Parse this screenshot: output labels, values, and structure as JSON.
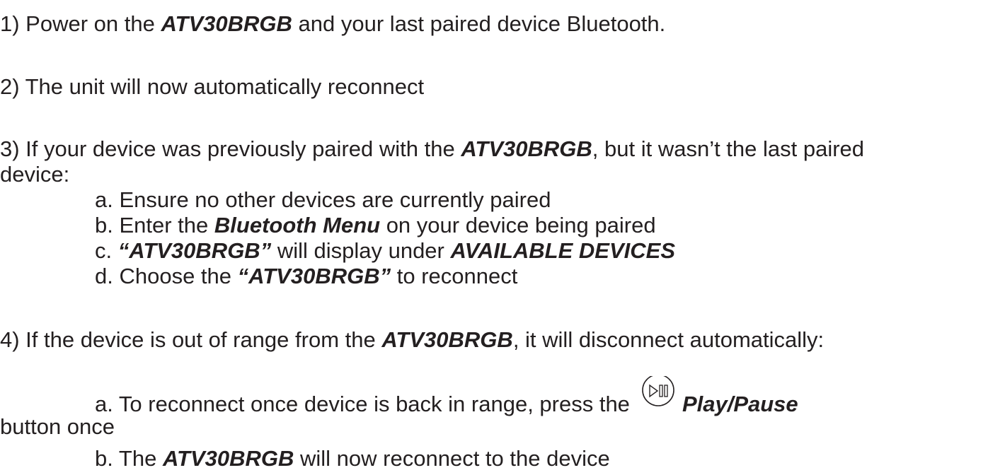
{
  "steps": {
    "s1": {
      "prefix": "1) Power on the ",
      "model": "ATV30BRGB",
      "suffix": " and your last paired device Bluetooth."
    },
    "s2": {
      "text": "2) The unit will now automatically reconnect"
    },
    "s3": {
      "prefix": "3) If your device was previously paired with the ",
      "model": "ATV30BRGB",
      "suffix": ", but it wasn’t the last paired",
      "continuation": "device:",
      "sub_a": "a. Ensure no other devices are currently paired",
      "sub_b_prefix": "b. Enter the ",
      "sub_b_emph": "Bluetooth Menu",
      "sub_b_suffix": " on your device being paired",
      "sub_c_prefix": "c. ",
      "sub_c_emph": "“ATV30BRGB”",
      "sub_c_mid": " will display under ",
      "sub_c_emph2": "AVAILABLE DEVICES",
      "sub_d_prefix": "d. Choose the ",
      "sub_d_emph": "“ATV30BRGB”",
      "sub_d_suffix": " to reconnect"
    },
    "s4": {
      "prefix": "4) If the device is out of range from the ",
      "model": "ATV30BRGB",
      "suffix": ", it will disconnect automatically:",
      "sub_a_prefix": "a. To reconnect once device is back in range, press the",
      "sub_a_icon": "play-pause-icon",
      "sub_a_emph": "Play/Pause",
      "sub_a_continuation": "button once",
      "sub_b_prefix": "b. The ",
      "sub_b_model": "ATV30BRGB",
      "sub_b_suffix": " will now reconnect to the device"
    }
  }
}
